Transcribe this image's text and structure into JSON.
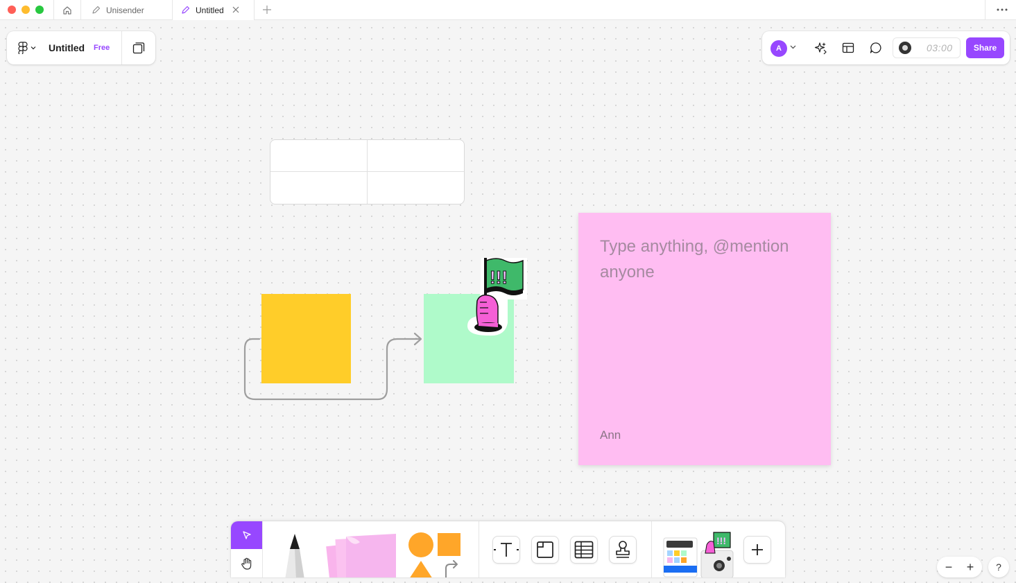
{
  "tabs": [
    {
      "label": "Unisender"
    },
    {
      "label": "Untitled"
    }
  ],
  "file": {
    "title": "Untitled",
    "plan_badge": "Free"
  },
  "header": {
    "avatar_initial": "A",
    "timer": "03:00",
    "share_label": "Share"
  },
  "sticky": {
    "placeholder": "Type anything, @mention anyone",
    "author": "Ann"
  },
  "colors": {
    "accent": "#9747ff",
    "yellow_shape": "#ffcd29",
    "green_shape": "#affaca",
    "sticky_pink": "#ffbdf2",
    "shape_orange": "#ffa629"
  },
  "icons": {
    "home": "home-icon",
    "tab_file": "pen-file-icon",
    "close": "close-icon",
    "add_tab": "plus-icon",
    "more": "more-horizontal-icon",
    "figjam_logo": "figjam-logo-icon",
    "pages": "pages-icon",
    "ai": "ai-sparkle-icon",
    "templates": "layout-icon",
    "comment": "comment-icon",
    "move": "cursor-icon",
    "hand": "hand-icon",
    "text": "text-icon",
    "section": "section-icon",
    "table": "table-icon",
    "stamp": "stamp-icon",
    "add": "plus-icon",
    "help": "question-icon"
  },
  "zoom": {
    "out_label": "−",
    "in_label": "+"
  },
  "help_label": "?"
}
